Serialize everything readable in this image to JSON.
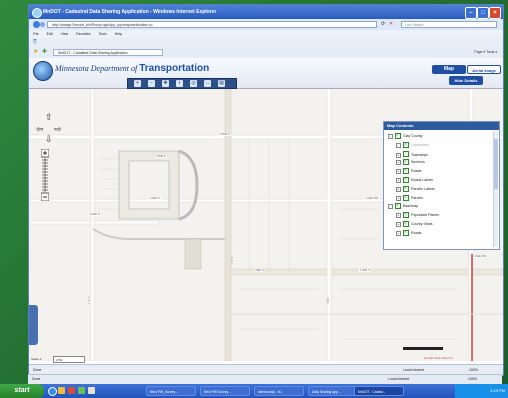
{
  "window": {
    "title": "MnDOT - Cadastral Data Sharing Application - Windows Internet Explorer"
  },
  "address": {
    "url": "http://dotapp7/mndot_bin/ProxyLoginApp_ipp/map/sanitization.rp",
    "search_placeholder": "Live Search"
  },
  "menu": [
    "File",
    "Edit",
    "View",
    "Favorites",
    "Tools",
    "Help"
  ],
  "tab": {
    "label": "MnDOT - Cadastral Data Sharing Application"
  },
  "toolbar_right": "Page ▾  Tools ▾",
  "header": {
    "agency": "Minnesota Department of",
    "agency_bold": "Transportation"
  },
  "view_buttons": {
    "map": "Map",
    "aerial": "Aerial Image",
    "hide": "Hide Details"
  },
  "toc": {
    "title": "Map Contents",
    "items": [
      {
        "label": "Clay County",
        "checked": true,
        "level": 0,
        "dim": false
      },
      {
        "label": "Landmarks",
        "checked": true,
        "level": 1,
        "dim": true
      },
      {
        "label": "Townships",
        "checked": false,
        "level": 1,
        "dim": false
      },
      {
        "label": "Sections",
        "checked": true,
        "level": 1,
        "dim": false
      },
      {
        "label": "Roads",
        "checked": true,
        "level": 1,
        "dim": false
      },
      {
        "label": "Roads Labels",
        "checked": true,
        "level": 1,
        "dim": false
      },
      {
        "label": "Parcels Labels",
        "checked": true,
        "level": 1,
        "dim": false
      },
      {
        "label": "Parcels",
        "checked": true,
        "level": 1,
        "dim": false
      },
      {
        "label": "Basemap",
        "checked": true,
        "level": 0,
        "dim": false
      },
      {
        "label": "Populated Places",
        "checked": true,
        "level": 1,
        "dim": false
      },
      {
        "label": "County Seats",
        "checked": true,
        "level": 1,
        "dim": false
      },
      {
        "label": "Roads",
        "checked": true,
        "level": 1,
        "dim": false
      }
    ]
  },
  "map_labels": {
    "road_top": "8 AVE N",
    "road_mid": "3 AVE N",
    "road_mid2": "4 AVE N",
    "road_left": "3 AVE N",
    "road_low": "1 AVE S",
    "road_low2": "1 AVE S",
    "road_right": "3 AVE SW",
    "road_far_right": "3 AVE SW",
    "road_vert1": "8 ST S",
    "road_vert2": "8 ST",
    "road_vert3": "8 ST S"
  },
  "scale": {
    "label": "Scale 1:",
    "value": "4731"
  },
  "current_zoom": "Current Tool: Zoom In",
  "status": {
    "left": "Done",
    "zone": "Local intranet",
    "zoom": "100%"
  },
  "taskbar": {
    "start": "start",
    "tasks": [
      "Next PW_Survey...",
      "Next PW Survey...",
      "sidebar.asp - M...",
      "Data Sharing App...",
      "MnDOT - Cadast..."
    ],
    "clock": "4:29 PM"
  }
}
